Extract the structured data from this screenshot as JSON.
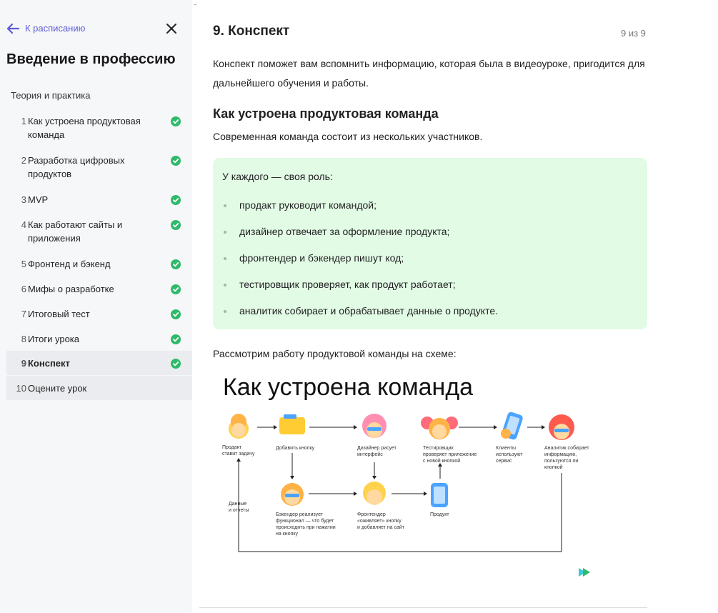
{
  "sidebar": {
    "back_label": "К расписанию",
    "course_title": "Введение в профессию",
    "section_label": "Теория и практика",
    "lessons": [
      {
        "num": "1",
        "title": "Как устроена продуктовая команда",
        "done": true
      },
      {
        "num": "2",
        "title": "Разработка цифровых продуктов",
        "done": true
      },
      {
        "num": "3",
        "title": "MVP",
        "done": true
      },
      {
        "num": "4",
        "title": "Как работают сайты и приложения",
        "done": true
      },
      {
        "num": "5",
        "title": "Фронтенд и бэкенд",
        "done": true
      },
      {
        "num": "6",
        "title": "Мифы о разработке",
        "done": true
      },
      {
        "num": "7",
        "title": "Итоговый тест",
        "done": true
      },
      {
        "num": "8",
        "title": "Итоги урока",
        "done": true
      },
      {
        "num": "9",
        "title": "Конспект",
        "done": true,
        "active": true
      },
      {
        "num": "10",
        "title": "Оцените урок",
        "done": false
      }
    ]
  },
  "main": {
    "title": "9. Конспект",
    "pager": "9 из 9",
    "intro": "Конспект поможет вам вспомнить информацию, которая была в видеоуроке, пригодится для дальнейшего обучения и работы.",
    "h2": "Как устроена продуктовая команда",
    "p2": "Современная команда состоит из нескольких участников.",
    "callout": {
      "lead": "У каждого — своя роль:",
      "items": [
        "продакт руководит командой;",
        "дизайнер отвечает за оформление продукта;",
        "фронтендер и бэкендер пишут код;",
        "тестировщик проверяет, как продукт работает;",
        "аналитик собирает и обрабатывает данные о продукте."
      ]
    },
    "p3": "Рассмотрим работу продуктовой команды на схеме:",
    "scheme": {
      "title": "Как устроена команда",
      "nodes": {
        "product": [
          "Продакт",
          "ставит задачу"
        ],
        "add_button": [
          "Добавить кнопку"
        ],
        "designer": [
          "Дизайнер рисует",
          "интерфейс"
        ],
        "tester": [
          "Тестировщик",
          "проверяет приложение",
          "с новой кнопкой"
        ],
        "clients": [
          "Клиенты",
          "используют",
          "сервис"
        ],
        "analyst": [
          "Аналитик собирает",
          "информацию,",
          "пользуются ли",
          "кнопкой"
        ],
        "data": [
          "Данные",
          "и отчеты"
        ],
        "backend": [
          "Бэкендер реализует",
          "функционал — что будет",
          "происходить при нажатии",
          "на кнопку"
        ],
        "frontend": [
          "Фронтендер",
          "«оживляет» кнопку",
          "и добавляет на сайт"
        ],
        "productlabel": [
          "Продукт"
        ]
      }
    }
  },
  "colors": {
    "accent": "#5b5bd6",
    "done": "#2fba6b",
    "callout_bg": "#e2fbe4",
    "sidebar_bg": "#f6f7f9"
  }
}
